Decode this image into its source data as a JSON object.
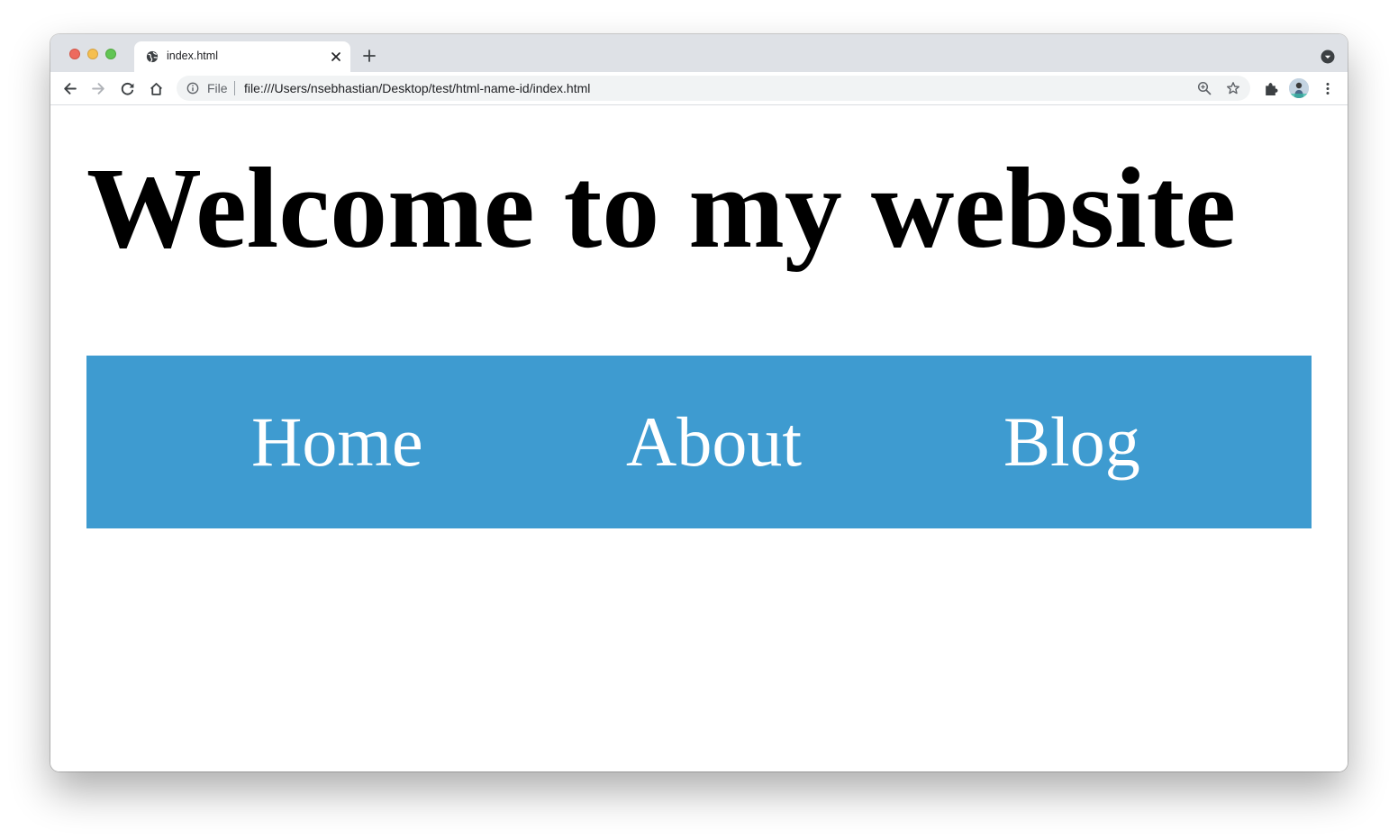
{
  "browser": {
    "tab": {
      "title": "index.html",
      "favicon": "globe-icon"
    },
    "address_bar": {
      "scheme_label": "File",
      "url": "file:///Users/nsebhastian/Desktop/test/html-name-id/index.html"
    },
    "icons": {
      "back": "arrow-left-icon",
      "forward": "arrow-right-icon",
      "reload": "reload-icon",
      "home": "home-icon",
      "info": "info-icon",
      "zoom": "zoom-icon",
      "bookmark": "star-icon",
      "extensions": "puzzle-icon",
      "menu": "kebab-icon"
    },
    "traffic_lights": {
      "close": "#ed6a5e",
      "minimize": "#f5bf4f",
      "maximize": "#61c554"
    }
  },
  "page": {
    "heading": "Welcome to my website",
    "nav": {
      "background": "#3e9bd0",
      "items": [
        {
          "label": "Home"
        },
        {
          "label": "About"
        },
        {
          "label": "Blog"
        }
      ]
    }
  }
}
